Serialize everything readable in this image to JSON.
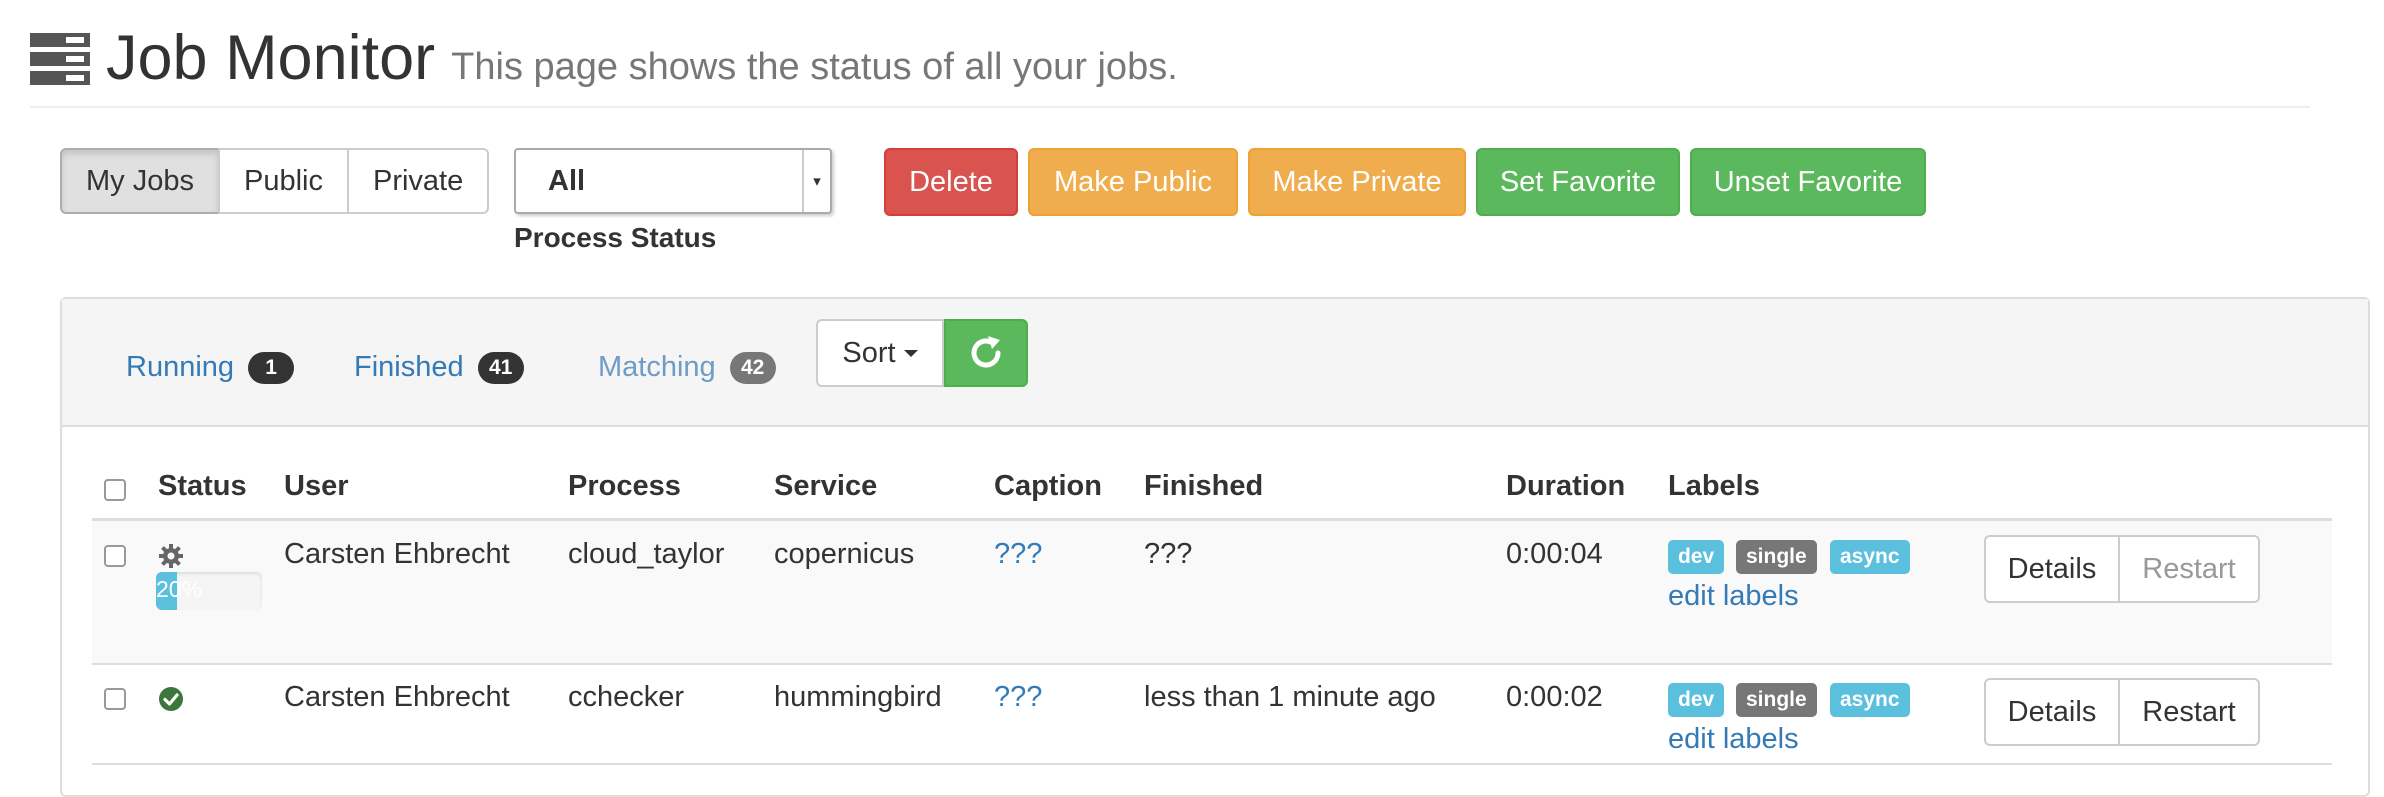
{
  "header": {
    "icon": "server-stack-icon",
    "title": "Job Monitor",
    "subtitle": "This page shows the status of all your jobs."
  },
  "toolbar": {
    "scope_buttons": [
      {
        "label": "My Jobs",
        "active": true
      },
      {
        "label": "Public",
        "active": false
      },
      {
        "label": "Private",
        "active": false
      }
    ],
    "status_select": {
      "value": "All",
      "label": "Process Status"
    },
    "actions": {
      "delete": "Delete",
      "make_public": "Make Public",
      "make_private": "Make Private",
      "set_favorite": "Set Favorite",
      "unset_favorite": "Unset Favorite"
    },
    "colors": {
      "danger": "#d9534f",
      "warning": "#f0ad4e",
      "success": "#5cb85c"
    }
  },
  "filters": {
    "running": {
      "label": "Running",
      "count": "1"
    },
    "finished": {
      "label": "Finished",
      "count": "41"
    },
    "matching": {
      "label": "Matching",
      "count": "42"
    },
    "sort_label": "Sort",
    "refresh_icon": "refresh-icon"
  },
  "table": {
    "columns": [
      "Status",
      "User",
      "Process",
      "Service",
      "Caption",
      "Finished",
      "Duration",
      "Labels"
    ],
    "rows": [
      {
        "status_icon": "gear-icon",
        "progress": 20,
        "progress_text": "20%",
        "user": "Carsten Ehbrecht",
        "process": "cloud_taylor",
        "service": "copernicus",
        "caption": "???",
        "finished": "???",
        "duration": "0:00:04",
        "labels": [
          "dev",
          "single",
          "async"
        ],
        "edit_labels": "edit labels",
        "details": "Details",
        "restart": "Restart",
        "restart_enabled": false
      },
      {
        "status_icon": "check-circle-icon",
        "user": "Carsten Ehbrecht",
        "process": "cchecker",
        "service": "hummingbird",
        "caption": "???",
        "finished": "less than 1 minute ago",
        "duration": "0:00:02",
        "labels": [
          "dev",
          "single",
          "async"
        ],
        "edit_labels": "edit labels",
        "details": "Details",
        "restart": "Restart",
        "restart_enabled": true
      }
    ]
  }
}
